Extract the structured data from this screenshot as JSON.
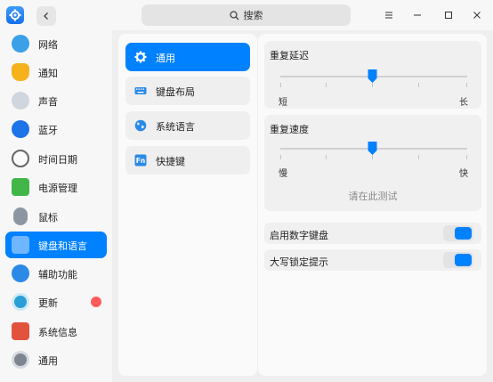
{
  "window": {
    "search_placeholder": "搜索",
    "accent_color": "#0081ff"
  },
  "sidebar": {
    "items": [
      {
        "label": "网络",
        "icon": "network-icon"
      },
      {
        "label": "通知",
        "icon": "bell-icon"
      },
      {
        "label": "声音",
        "icon": "speaker-icon"
      },
      {
        "label": "蓝牙",
        "icon": "bluetooth-icon"
      },
      {
        "label": "时间日期",
        "icon": "clock-icon"
      },
      {
        "label": "电源管理",
        "icon": "battery-icon"
      },
      {
        "label": "鼠标",
        "icon": "mouse-icon"
      },
      {
        "label": "键盘和语言",
        "icon": "keyboard-language-icon",
        "active": true
      },
      {
        "label": "辅助功能",
        "icon": "accessibility-icon"
      },
      {
        "label": "更新",
        "icon": "update-icon",
        "badge": true
      },
      {
        "label": "系统信息",
        "icon": "system-info-icon"
      },
      {
        "label": "通用",
        "icon": "general-icon"
      }
    ]
  },
  "submenu": {
    "items": [
      {
        "label": "通用",
        "icon": "gear-icon",
        "active": true
      },
      {
        "label": "键盘布局",
        "icon": "keyboard-icon"
      },
      {
        "label": "系统语言",
        "icon": "globe-icon"
      },
      {
        "label": "快捷键",
        "icon": "fn-key-icon"
      }
    ]
  },
  "settings": {
    "repeat_delay": {
      "title": "重复延迟",
      "min_label": "短",
      "max_label": "长",
      "value_fraction": 0.5
    },
    "repeat_speed": {
      "title": "重复速度",
      "min_label": "慢",
      "max_label": "快",
      "value_fraction": 0.5,
      "test_placeholder": "请在此测试"
    },
    "numlock": {
      "label": "启用数字键盘",
      "enabled": true
    },
    "capslock_hint": {
      "label": "大写锁定提示",
      "enabled": true
    }
  }
}
